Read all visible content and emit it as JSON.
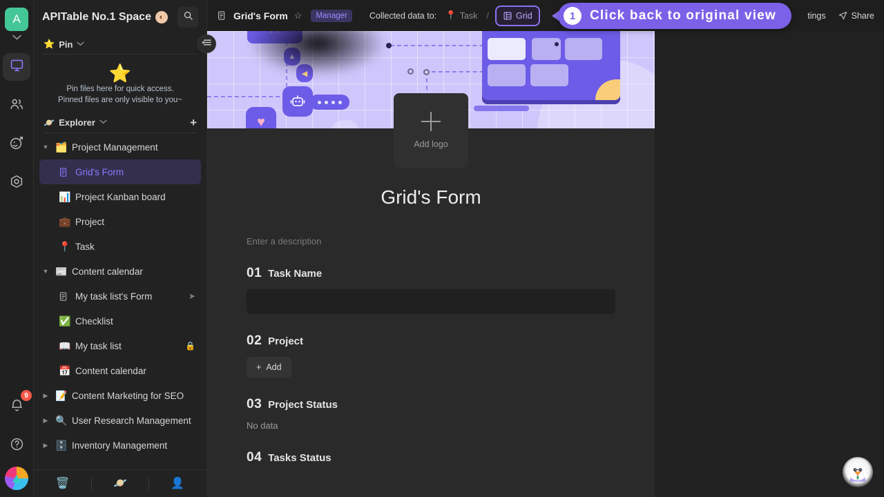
{
  "rail": {
    "avatar_letter": "A",
    "items": [
      {
        "name": "workbench-icon",
        "label": "Workbench"
      },
      {
        "name": "members-icon",
        "label": "Members"
      },
      {
        "name": "automation-icon",
        "label": "Automation"
      },
      {
        "name": "template-icon",
        "label": "Template"
      }
    ],
    "notification_count": "9",
    "help_label": "?"
  },
  "sidebar": {
    "space_name": "APITable No.1 Space",
    "space_badge": "◐",
    "search_icon": "search-icon",
    "pin": {
      "label": "Pin",
      "star": "⭐",
      "empty_line1": "Pin files here for quick access.",
      "empty_line2": "Pinned files are only visible to you~"
    },
    "explorer": {
      "label": "Explorer",
      "emoji": "🪐",
      "add_label": "+"
    },
    "tree": [
      {
        "level": 1,
        "arrow": "▼",
        "emoji": "🗂️",
        "label": "Project Management",
        "selected": false,
        "tail": "",
        "icon": ""
      },
      {
        "level": 2,
        "arrow": "",
        "emoji": "",
        "label": "Grid's Form",
        "selected": true,
        "tail": "",
        "icon": "form-icon"
      },
      {
        "level": 2,
        "arrow": "",
        "emoji": "📊",
        "label": "Project Kanban board",
        "selected": false,
        "tail": "",
        "icon": ""
      },
      {
        "level": 2,
        "arrow": "",
        "emoji": "💼",
        "label": "Project",
        "selected": false,
        "tail": "",
        "icon": ""
      },
      {
        "level": 2,
        "arrow": "",
        "emoji": "📍",
        "label": "Task",
        "selected": false,
        "tail": "",
        "icon": ""
      },
      {
        "level": 1,
        "arrow": "▼",
        "emoji": "📰",
        "label": "Content calendar",
        "selected": false,
        "tail": "",
        "icon": ""
      },
      {
        "level": 2,
        "arrow": "",
        "emoji": "",
        "label": "My task list's Form",
        "selected": false,
        "tail": "➤",
        "icon": "form-icon"
      },
      {
        "level": 2,
        "arrow": "",
        "emoji": "✅",
        "label": "Checklist",
        "selected": false,
        "tail": "",
        "icon": ""
      },
      {
        "level": 2,
        "arrow": "",
        "emoji": "📖",
        "label": "My task list",
        "selected": false,
        "tail": "🔒",
        "icon": ""
      },
      {
        "level": 2,
        "arrow": "",
        "emoji": "📅",
        "label": "Content calendar",
        "selected": false,
        "tail": "",
        "icon": ""
      },
      {
        "level": 1,
        "arrow": "▶",
        "emoji": "📝",
        "label": "Content Marketing for SEO",
        "selected": false,
        "tail": "",
        "icon": ""
      },
      {
        "level": 1,
        "arrow": "▶",
        "emoji": "🔍",
        "label": "User Research Management",
        "selected": false,
        "tail": "",
        "icon": ""
      },
      {
        "level": 1,
        "arrow": "▶",
        "emoji": "🗄️",
        "label": "Inventory Management",
        "selected": false,
        "tail": "",
        "icon": ""
      }
    ],
    "footer": [
      {
        "name": "trash-icon",
        "glyph": "🗑️"
      },
      {
        "name": "template-icon",
        "glyph": "🪐"
      },
      {
        "name": "invite-member-icon",
        "glyph": "👤"
      }
    ],
    "collapse_icon": "collapse-sidebar-icon"
  },
  "topbar": {
    "form_icon": "form-icon",
    "form_name": "Grid's Form",
    "star_icon": "☆",
    "role_badge": "Manager",
    "collected_label": "Collected data to:",
    "source_datasheet": "Task",
    "source_datasheet_emoji": "📍",
    "separator": "/",
    "source_view": "Grid",
    "settings_label": "tings",
    "share_label": "Share"
  },
  "callout": {
    "number": "1",
    "text": "Click back to original view"
  },
  "form": {
    "logo_placeholder": "Add logo",
    "title": "Grid's Form",
    "description_placeholder": "Enter a description",
    "questions": [
      {
        "num": "01",
        "label": "Task Name",
        "type": "input",
        "value": "",
        "extra": ""
      },
      {
        "num": "02",
        "label": "Project",
        "type": "add",
        "value": "",
        "extra": "Add"
      },
      {
        "num": "03",
        "label": "Project Status",
        "type": "empty",
        "value": "",
        "extra": "No data"
      },
      {
        "num": "04",
        "label": "Tasks Status",
        "type": "empty",
        "value": "",
        "extra": ""
      }
    ]
  },
  "mascot": {
    "name": "assistant-mascot"
  },
  "colors": {
    "accent": "#7b61e8",
    "sidebar_bg": "#222222",
    "panel_bg": "#2a2a2a",
    "selected_bg": "#332f4d",
    "badge_red": "#f5584a",
    "avatar_green": "#43c796"
  }
}
